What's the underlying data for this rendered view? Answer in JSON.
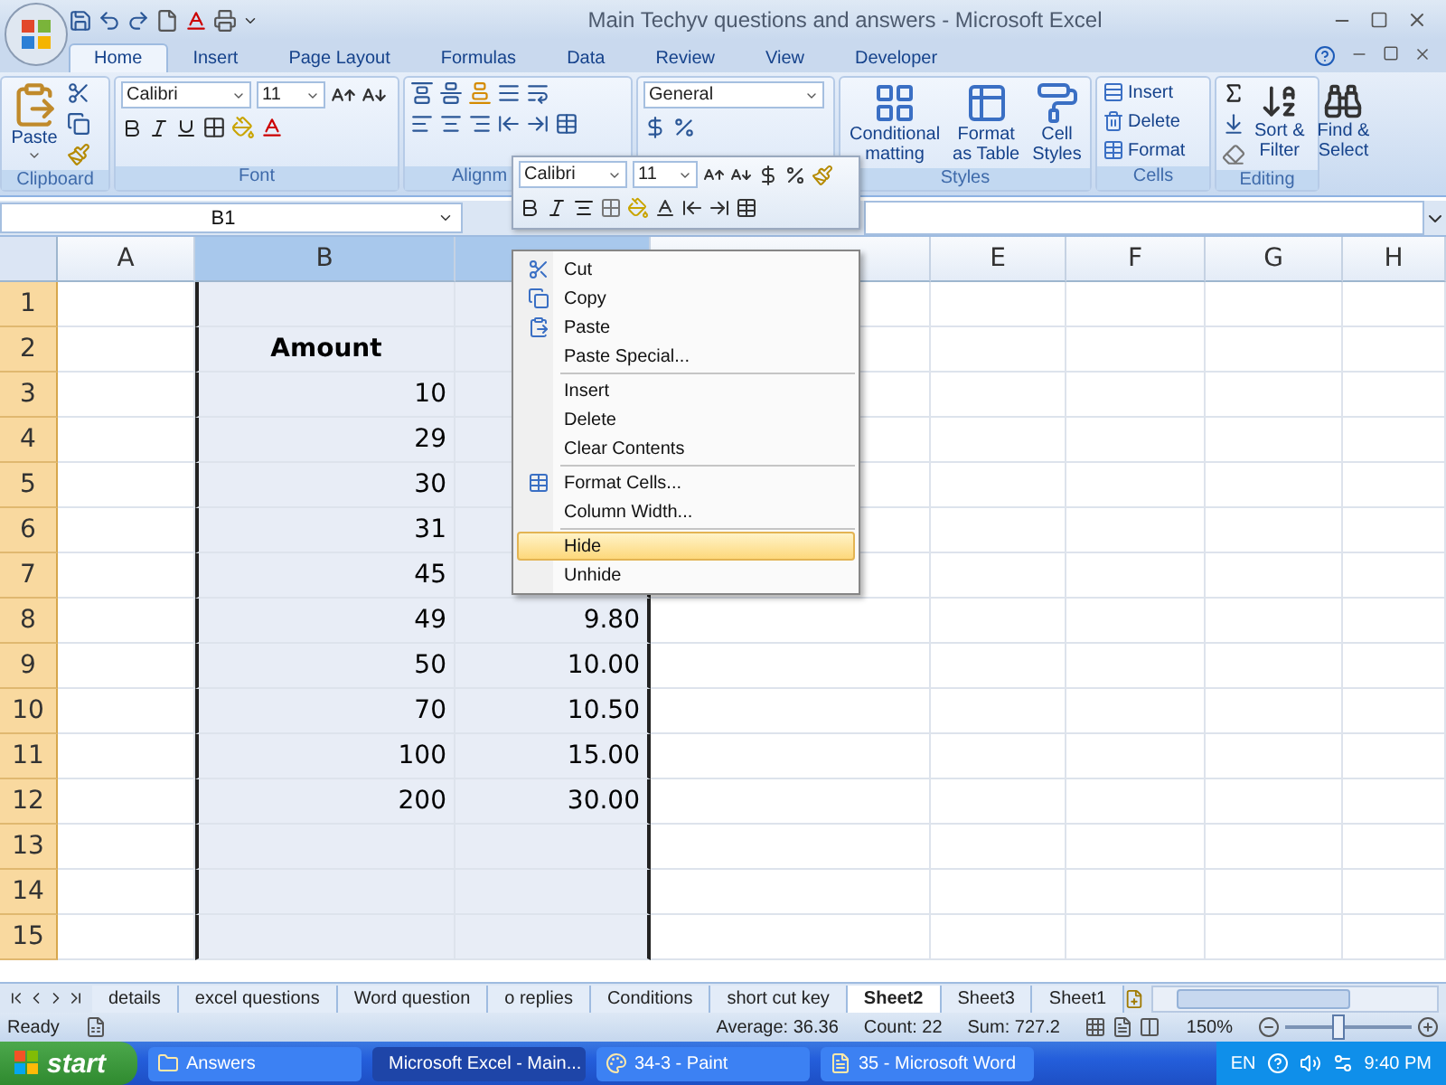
{
  "window": {
    "title": "Main Techyv questions and answers - Microsoft Excel"
  },
  "tabs": [
    {
      "label": "Home",
      "selected": true
    },
    {
      "label": "Insert",
      "selected": false
    },
    {
      "label": "Page Layout",
      "selected": false
    },
    {
      "label": "Formulas",
      "selected": false
    },
    {
      "label": "Data",
      "selected": false
    },
    {
      "label": "Review",
      "selected": false
    },
    {
      "label": "View",
      "selected": false
    },
    {
      "label": "Developer",
      "selected": false
    }
  ],
  "ribbon": {
    "groups": [
      {
        "kind": "clipboard",
        "label": "Clipboard",
        "paste": "Paste"
      },
      {
        "kind": "font",
        "label": "Font",
        "font": "Calibri",
        "size": "11"
      },
      {
        "kind": "alignment",
        "label": "Alignm"
      },
      {
        "kind": "number",
        "format": "General"
      },
      {
        "kind": "styles",
        "label": "Styles",
        "buttons": [
          {
            "lines": [
              "Conditional",
              "matting"
            ]
          },
          {
            "lines": [
              "Format",
              "as Table"
            ]
          },
          {
            "lines": [
              "Cell",
              "Styles"
            ]
          }
        ]
      },
      {
        "kind": "cells",
        "label": "Cells",
        "buttons": [
          "Insert",
          "Delete",
          "Format"
        ]
      },
      {
        "kind": "editing",
        "label": "Editing",
        "buttons": [
          {
            "lines": [
              "Sort &",
              "Filter"
            ]
          },
          {
            "lines": [
              "Find &",
              "Select"
            ]
          }
        ]
      }
    ]
  },
  "formula_bar": {
    "name_box": "B1"
  },
  "columns": [
    {
      "label": "A",
      "selected": false
    },
    {
      "label": "B",
      "selected": true
    },
    {
      "selected": true
    },
    {
      "selected": false
    },
    {
      "label": "E",
      "selected": false
    },
    {
      "label": "F",
      "selected": false
    },
    {
      "label": "G",
      "selected": false
    },
    {
      "label": "H",
      "selected": false
    }
  ],
  "rows": [
    {
      "number": "1",
      "kind": "value"
    },
    {
      "number": "2",
      "kind": "heading",
      "b": "Amount"
    },
    {
      "number": "3",
      "kind": "value",
      "b": "10"
    },
    {
      "number": "4",
      "kind": "value",
      "b": "29"
    },
    {
      "number": "5",
      "kind": "value",
      "b": "30"
    },
    {
      "number": "6",
      "kind": "value",
      "b": "31"
    },
    {
      "number": "7",
      "kind": "value",
      "b": "45"
    },
    {
      "number": "8",
      "kind": "value",
      "b": "49",
      "c": "9.80"
    },
    {
      "number": "9",
      "kind": "value",
      "b": "50",
      "c": "10.00"
    },
    {
      "number": "10",
      "kind": "value",
      "b": "70",
      "c": "10.50"
    },
    {
      "number": "11",
      "kind": "value",
      "b": "100",
      "c": "15.00"
    },
    {
      "number": "12",
      "kind": "value",
      "b": "200",
      "c": "30.00"
    },
    {
      "number": "13",
      "kind": "value"
    },
    {
      "number": "14",
      "kind": "value"
    },
    {
      "number": "15",
      "kind": "value"
    }
  ],
  "mini_toolbar": {
    "font": "Calibri",
    "size": "11"
  },
  "context_menu": {
    "groups": [
      [
        {
          "label": "Cut",
          "kind": "cut",
          "selected": false
        },
        {
          "label": "Copy",
          "kind": "copy",
          "selected": false
        },
        {
          "label": "Paste",
          "kind": "paste",
          "selected": false
        },
        {
          "label": "Paste Special...",
          "kind": "plain",
          "selected": false
        }
      ],
      [
        {
          "label": "Insert",
          "kind": "plain",
          "selected": false
        },
        {
          "label": "Delete",
          "kind": "plain",
          "selected": false
        },
        {
          "label": "Clear Contents",
          "kind": "plain",
          "selected": false
        }
      ],
      [
        {
          "label": "Format Cells...",
          "kind": "format",
          "selected": false
        },
        {
          "label": "Column Width...",
          "kind": "plain",
          "selected": false
        }
      ],
      [
        {
          "label": "Hide",
          "kind": "plain",
          "selected": true
        },
        {
          "label": "Unhide",
          "kind": "plain",
          "selected": false
        }
      ]
    ]
  },
  "sheet_tabs": [
    {
      "label": "details",
      "selected": false
    },
    {
      "label": "excel questions",
      "selected": false
    },
    {
      "label": "Word question",
      "selected": false
    },
    {
      "label": "o replies",
      "selected": false
    },
    {
      "label": "Conditions",
      "selected": false
    },
    {
      "label": "short cut key",
      "selected": false
    },
    {
      "label": "Sheet2",
      "selected": true
    },
    {
      "label": "Sheet3",
      "selected": false
    },
    {
      "label": "Sheet1",
      "selected": false
    }
  ],
  "status_bar": {
    "mode": "Ready",
    "average": "Average: 36.36",
    "count": "Count: 22",
    "sum": "Sum: 727.2",
    "zoom": "150%",
    "zoom_slider": {
      "level": 0.42
    }
  },
  "taskbar": {
    "start": "start",
    "buttons": [
      {
        "label": "Answers",
        "kind": "folder",
        "selected": false
      },
      {
        "label": "Microsoft Excel - Main...",
        "kind": "excel",
        "selected": true
      },
      {
        "label": "34-3 - Paint",
        "kind": "paint",
        "selected": false
      },
      {
        "label": "35 - Microsoft Word",
        "kind": "word",
        "selected": false
      }
    ],
    "language": "EN",
    "clock": "9:40 PM"
  }
}
